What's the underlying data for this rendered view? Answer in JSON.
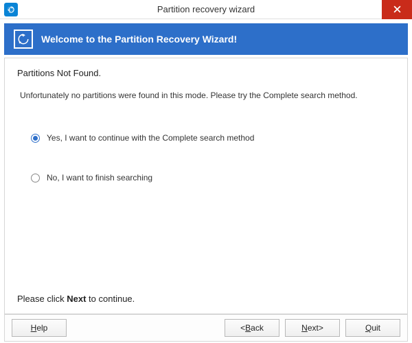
{
  "titlebar": {
    "title": "Partition recovery wizard"
  },
  "banner": {
    "title": "Welcome to the Partition Recovery Wizard!"
  },
  "content": {
    "heading": "Partitions Not Found.",
    "subtext": "Unfortunately no partitions were found in this mode. Please try the Complete search method.",
    "options": [
      {
        "label": "Yes, I want to continue with the Complete search method",
        "selected": true
      },
      {
        "label": "No, I want to finish searching",
        "selected": false
      }
    ],
    "instruction_pre": "Please click ",
    "instruction_bold": "Next",
    "instruction_post": " to continue."
  },
  "footer": {
    "help": "Help",
    "back": "Back",
    "next": "Next",
    "quit": "Quit"
  }
}
